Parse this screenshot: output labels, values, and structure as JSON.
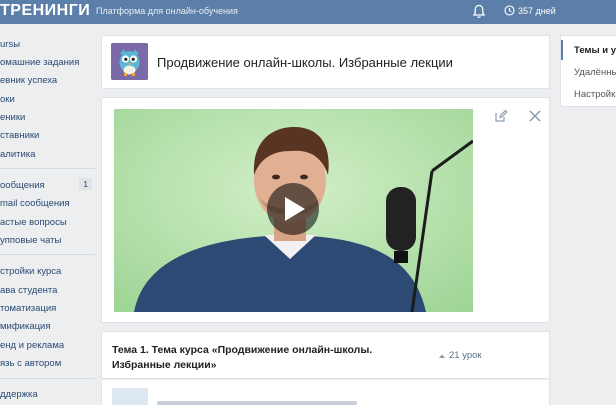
{
  "topbar": {
    "brand": "ТРЕНИНГИ",
    "subtitle": "Платформа для онлайн-обучения",
    "days": "357 дней",
    "bg_color": "#5b7fa8"
  },
  "sidebar": {
    "items": [
      {
        "label": "ursы"
      },
      {
        "label": "омашние задания"
      },
      {
        "label": "евник успеха"
      },
      {
        "label": "оки"
      },
      {
        "label": "еники"
      },
      {
        "label": "ставники"
      },
      {
        "label": "алитика"
      },
      {
        "label": "ообщения",
        "badge": "1"
      },
      {
        "label": "mail сообщения"
      },
      {
        "label": "астые вопросы"
      },
      {
        "label": "упповые чаты"
      },
      {
        "label": "стройки курса"
      },
      {
        "label": "ава студента"
      },
      {
        "label": "томатизация"
      },
      {
        "label": "мификация"
      },
      {
        "label": "енд и реклама"
      },
      {
        "label": "язь с автором"
      },
      {
        "label": "ддержка"
      }
    ]
  },
  "course": {
    "title": "Продвижение онлайн-школы. Избранные лекции"
  },
  "video": {
    "play_icon": "play-icon"
  },
  "topic": {
    "title": "Тема 1. Тема курса «Продвижение онлайн-школы. Избранные лекции»",
    "count": "21 урок"
  },
  "right_panel": {
    "items": [
      {
        "label": "Темы и уроки",
        "active": true
      },
      {
        "label": "Удалённые"
      },
      {
        "label": "Настройки"
      }
    ]
  }
}
